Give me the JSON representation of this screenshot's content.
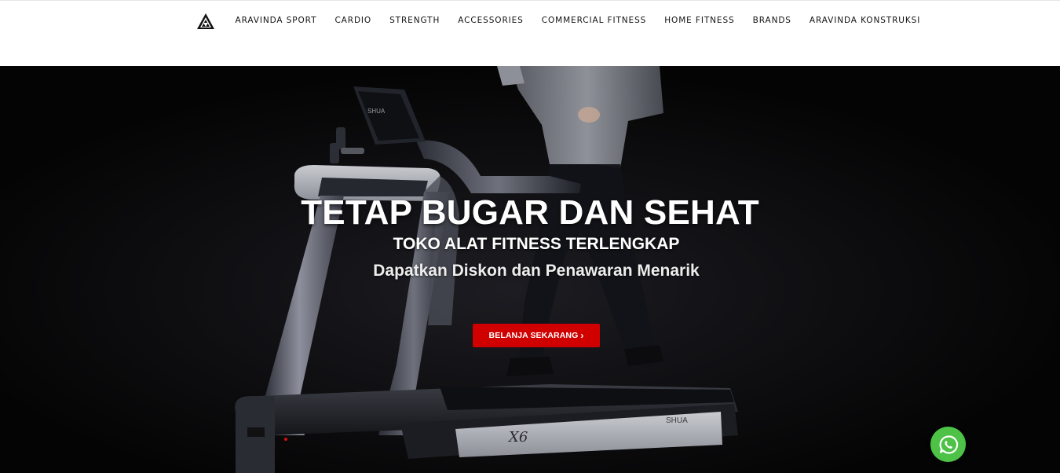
{
  "header": {
    "logo_icon": "aravinda-triangle-logo-icon",
    "nav": [
      "ARAVINDA SPORT",
      "CARDIO",
      "STRENGTH",
      "ACCESSORIES",
      "COMMERCIAL FITNESS",
      "HOME FITNESS",
      "BRANDS",
      "ARAVINDA KONSTRUKSI"
    ]
  },
  "hero": {
    "title": "TETAP BUGAR DAN SEHAT",
    "subtitle": "TOKO ALAT FITNESS TERLENGKAP",
    "tagline": "Dapatkan Diskon dan Penawaran Menarik",
    "cta_label": "BELANJA SEKARANG",
    "cta_icon": "chevron-right-icon",
    "cta_color": "#d10000",
    "image": {
      "brand": "SHUA",
      "model": "X6"
    }
  },
  "whatsapp": {
    "icon": "whatsapp-icon",
    "color": "#4dc247"
  }
}
